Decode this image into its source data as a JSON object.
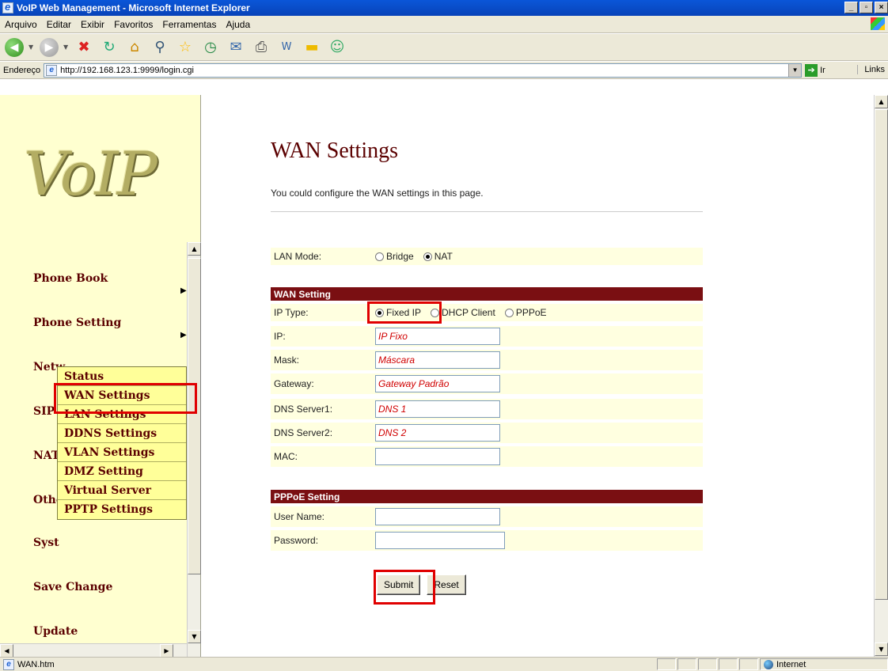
{
  "window": {
    "title": "VoIP Web Management - Microsoft Internet Explorer"
  },
  "menubar": {
    "items": [
      "Arquivo",
      "Editar",
      "Exibir",
      "Favoritos",
      "Ferramentas",
      "Ajuda"
    ]
  },
  "addressbar": {
    "label": "Endereço",
    "url": "http://192.168.123.1:9999/login.cgi",
    "go_label": "Ir",
    "links_label": "Links"
  },
  "logo": {
    "text": "VoIP"
  },
  "nav": {
    "items": [
      {
        "label": "Phone Book"
      },
      {
        "label": "Phone Setting"
      },
      {
        "label": "Netw"
      },
      {
        "label": "SIP"
      },
      {
        "label": "NAT"
      },
      {
        "label": "Othe"
      },
      {
        "label": "Syst"
      },
      {
        "label": "Save Change"
      },
      {
        "label": "Update"
      }
    ],
    "submenu": [
      "Status",
      "WAN Settings",
      "LAN Settings",
      "DDNS Settings",
      "VLAN Settings",
      "DMZ Setting",
      "Virtual Server",
      "PPTP Settings"
    ]
  },
  "page": {
    "title": "WAN Settings",
    "description": "You could configure the WAN settings in this page.",
    "lan_mode": {
      "label": "LAN Mode:",
      "options": [
        "Bridge",
        "NAT"
      ],
      "selected": "NAT"
    },
    "wan_setting": {
      "header": "WAN Setting",
      "ip_type_label": "IP Type:",
      "ip_type_options": [
        "Fixed IP",
        "DHCP Client",
        "PPPoE"
      ],
      "ip_type_selected": "Fixed IP",
      "fields": [
        {
          "label": "IP:",
          "value": "IP Fixo"
        },
        {
          "label": "Mask:",
          "value": "Máscara"
        },
        {
          "label": "Gateway:",
          "value": "Gateway Padrão"
        },
        {
          "label": "DNS Server1:",
          "value": "DNS 1"
        },
        {
          "label": "DNS Server2:",
          "value": "DNS 2"
        },
        {
          "label": "MAC:",
          "value": ""
        }
      ]
    },
    "pppoe_setting": {
      "header": "PPPoE Setting",
      "user_label": "User Name:",
      "user_value": "",
      "password_label": "Password:",
      "password_value": ""
    },
    "submit_label": "Submit",
    "reset_label": "Reset"
  },
  "statusbar": {
    "text": "WAN.htm",
    "zone": "Internet"
  },
  "colors": {
    "section_header": "#7a0f12",
    "row_background": "#ffffe0",
    "nav_background": "#ffffd0",
    "submenu_background": "#ffff99",
    "highlight": "#e00000",
    "field_value_text": "#d00000"
  }
}
